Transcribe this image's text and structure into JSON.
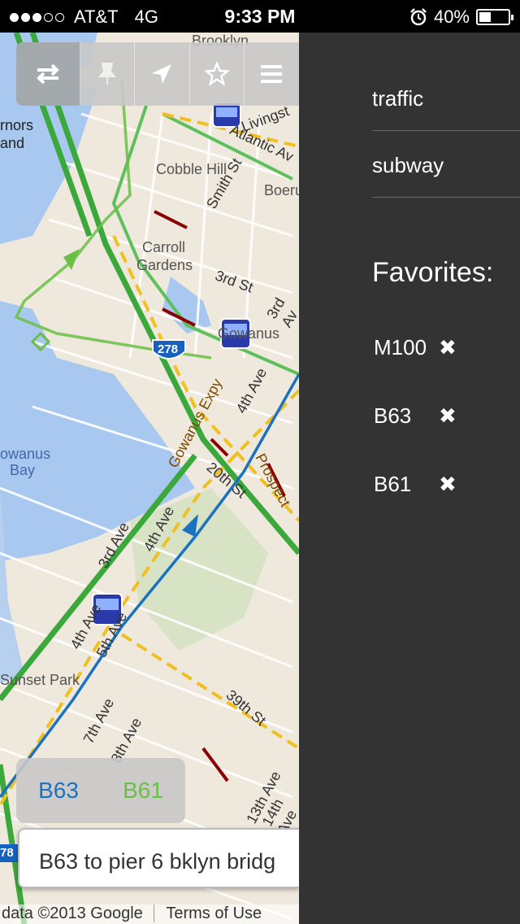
{
  "status_bar": {
    "carrier": "AT&T",
    "network": "4G",
    "time": "9:33 PM",
    "battery": "40%",
    "signal_bars": 3,
    "signal_total": 5,
    "battery_level": 0.4
  },
  "toolbar": {
    "icons": [
      "swap-icon",
      "pin-icon",
      "location-arrow-icon",
      "star-icon",
      "menu-icon"
    ]
  },
  "map": {
    "labels": {
      "governors": "rnors",
      "governors2": "and",
      "cobble_hill": "Cobble Hill",
      "boerum": "Boeru",
      "carroll": "Carroll",
      "gardens": "Gardens",
      "smith_st": "Smith St",
      "third_st": "3rd St",
      "third_av": "3rd Av",
      "gowanus": "Gowanus",
      "shield": "278",
      "gowanus_expy": "Gowanus Expy",
      "fourth_ave": "4th Ave",
      "prospect": "Prospect",
      "twentieth": "20th St",
      "gowanus_bay": "owanus",
      "bay": "Bay",
      "third_ave": "3rd Ave",
      "fourth_ave2": "4th Ave",
      "fourth_ave3": "4th Ave",
      "fifth_ave": "5th Ave",
      "sunset_park": "Sunset Park",
      "seventh_ave": "7th Ave",
      "eighth_ave": "8th Ave",
      "thirtyninth": "39th St",
      "thirteenth": "13th Ave",
      "fourteenth": "14th Ave",
      "brooklyn": "Brooklyn",
      "livingston": "Livingst",
      "atlantic": "Atlantic Av",
      "shield2": "78"
    }
  },
  "route_tabs": {
    "b63": "B63",
    "b61": "B61",
    "b63_color": "#1a72c0",
    "b61_color": "#6abf44"
  },
  "info": {
    "text": "B63 to pier 6 bklyn bridg"
  },
  "attribution": {
    "data": "data ©2013 Google",
    "terms": "Terms of Use"
  },
  "menu": {
    "traffic": "traffic",
    "subway": "subway",
    "favorites_heading": "Favorites:",
    "favorites": [
      {
        "name": "M100",
        "remove": "✖"
      },
      {
        "name": "B63",
        "remove": "✖"
      },
      {
        "name": "B61",
        "remove": "✖"
      }
    ]
  }
}
